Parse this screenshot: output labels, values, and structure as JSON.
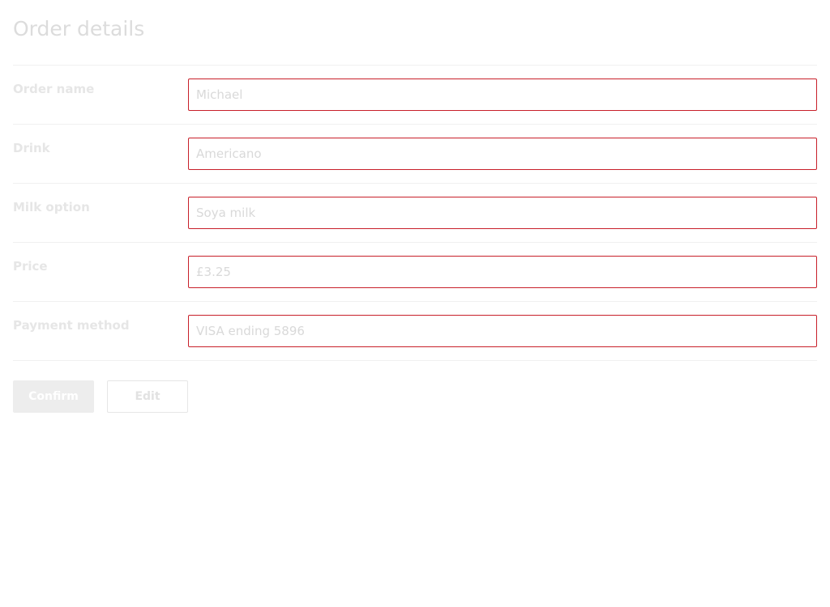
{
  "page": {
    "title": "Order details"
  },
  "form": {
    "rows": [
      {
        "label": "Order name",
        "value": "Michael"
      },
      {
        "label": "Drink",
        "value": "Americano"
      },
      {
        "label": "Milk option",
        "value": "Soya milk"
      },
      {
        "label": "Price",
        "value": "£3.25"
      },
      {
        "label": "Payment method",
        "value": "VISA ending 5896"
      }
    ]
  },
  "actions": {
    "confirm_label": "Confirm",
    "edit_label": "Edit"
  },
  "colors": {
    "field_border": "#c8202a"
  }
}
